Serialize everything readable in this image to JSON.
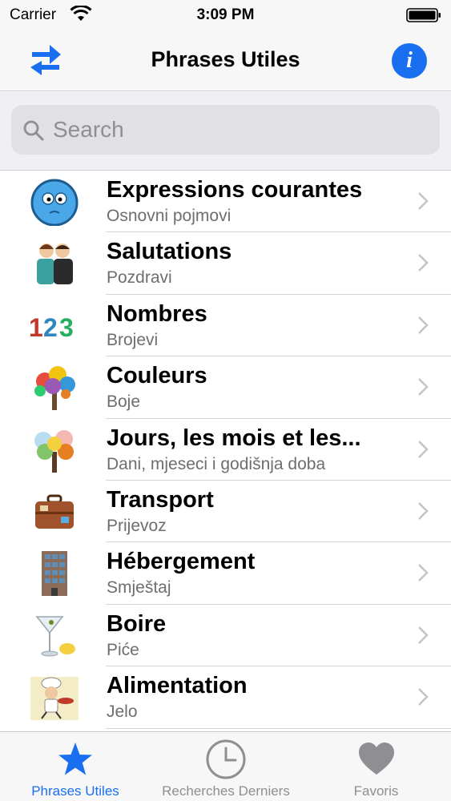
{
  "status_bar": {
    "carrier": "Carrier",
    "time": "3:09 PM"
  },
  "nav": {
    "title": "Phrases Utiles",
    "left_icon": "swap-arrows-icon",
    "right_icon": "info-icon",
    "info_glyph": "i"
  },
  "search": {
    "placeholder": "Search",
    "value": ""
  },
  "categories": [
    {
      "title": "Expressions courantes",
      "subtitle": "Osnovni pojmovi",
      "icon": "smiley-face-icon"
    },
    {
      "title": "Salutations",
      "subtitle": "Pozdravi",
      "icon": "greeting-people-icon"
    },
    {
      "title": "Nombres",
      "subtitle": "Brojevi",
      "icon": "numbers-icon",
      "icon_text": "123"
    },
    {
      "title": "Couleurs",
      "subtitle": "Boje",
      "icon": "colorful-tree-icon"
    },
    {
      "title": "Jours, les mois et les...",
      "subtitle": "Dani, mjeseci i godišnja doba",
      "icon": "seasons-tree-icon"
    },
    {
      "title": "Transport",
      "subtitle": "Prijevoz",
      "icon": "suitcase-icon"
    },
    {
      "title": "Hébergement",
      "subtitle": "Smještaj",
      "icon": "building-icon"
    },
    {
      "title": "Boire",
      "subtitle": "Piće",
      "icon": "cocktail-icon"
    },
    {
      "title": "Alimentation",
      "subtitle": "Jelo",
      "icon": "chef-icon"
    }
  ],
  "tabs": [
    {
      "label": "Phrases Utiles",
      "icon": "star-icon",
      "active": true
    },
    {
      "label": "Recherches Derniers",
      "icon": "clock-icon",
      "active": false
    },
    {
      "label": "Favoris",
      "icon": "heart-icon",
      "active": false
    }
  ],
  "colors": {
    "accent": "#1a6ff0",
    "inactive": "#8e8e93",
    "background": "#f7f7f7"
  }
}
